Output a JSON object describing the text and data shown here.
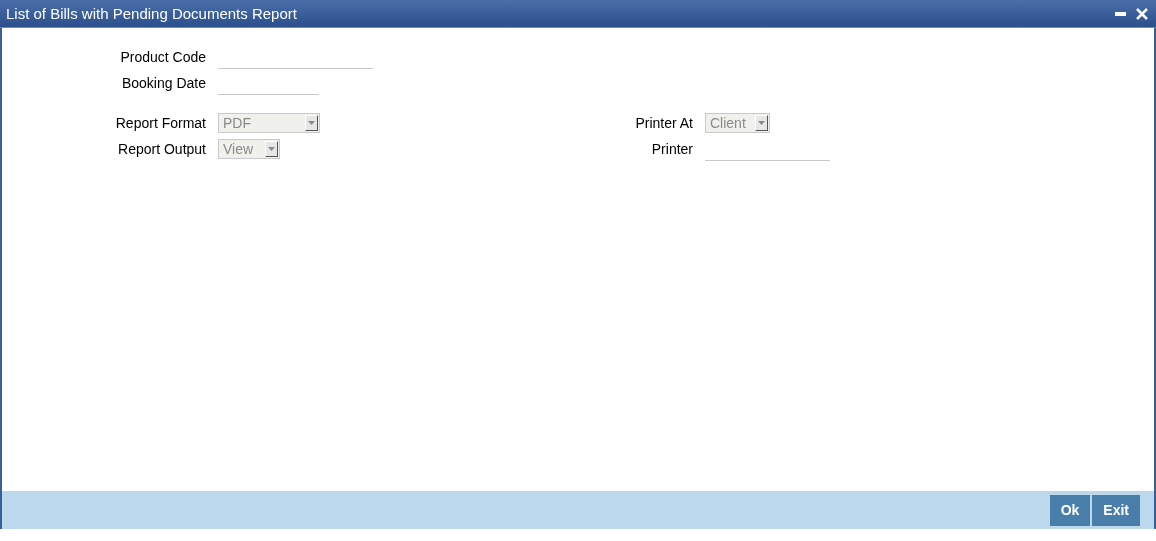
{
  "window": {
    "title": "List of Bills with Pending Documents Report"
  },
  "groups": [
    {
      "fields": [
        {
          "kind": "text",
          "label": "Product Code"
        },
        {
          "kind": "text",
          "label": "Booking Date"
        }
      ]
    },
    {
      "fields": [
        {
          "kind": "select",
          "label": "Report Format",
          "value": "PDF",
          "disabled": true
        },
        {
          "kind": "select",
          "label": "Report Output",
          "value": "View",
          "disabled": true
        }
      ],
      "side_fields": [
        {
          "kind": "select",
          "label": "Printer At",
          "value": "Client",
          "disabled": true
        },
        {
          "kind": "text",
          "label": "Printer"
        }
      ]
    }
  ],
  "buttons": [
    "Ok",
    "Exit"
  ]
}
